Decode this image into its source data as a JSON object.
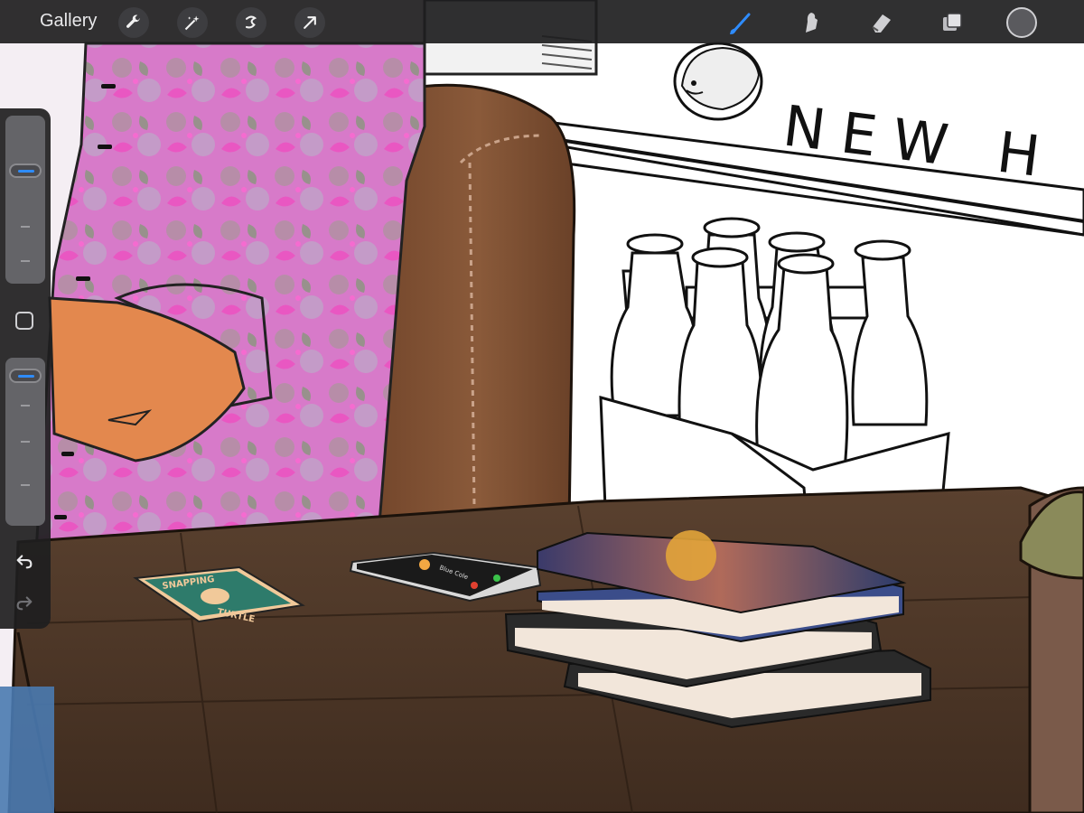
{
  "app": {
    "toolbar": {
      "gallery_label": "Gallery",
      "left_tools": [
        "wrench-icon",
        "magic-wand-icon",
        "selection-icon",
        "transform-arrow-icon"
      ],
      "right_tools": [
        "brush-icon",
        "smudge-icon",
        "eraser-icon",
        "layers-icon"
      ],
      "active_tool": "brush-icon",
      "current_color": "#5a5a5e"
    },
    "sidebar": {
      "brush_size_level": 0.7,
      "opacity_level": 0.95,
      "buttons": [
        "modify-button",
        "undo-icon",
        "redo-icon"
      ]
    }
  },
  "artwork": {
    "banner_text": "NEW H",
    "coaster_line1": "SNAPPING",
    "coaster_line2": "TURTLE",
    "phone_caller": "Blue Cole",
    "colors": {
      "wall": "#ffffff",
      "table": "#4e3829",
      "chair": "#7d4c30",
      "shirt": "#d878c8",
      "skin": "#e3884e",
      "coaster": "#2e7b6b",
      "accent": "#2e8cff"
    }
  }
}
